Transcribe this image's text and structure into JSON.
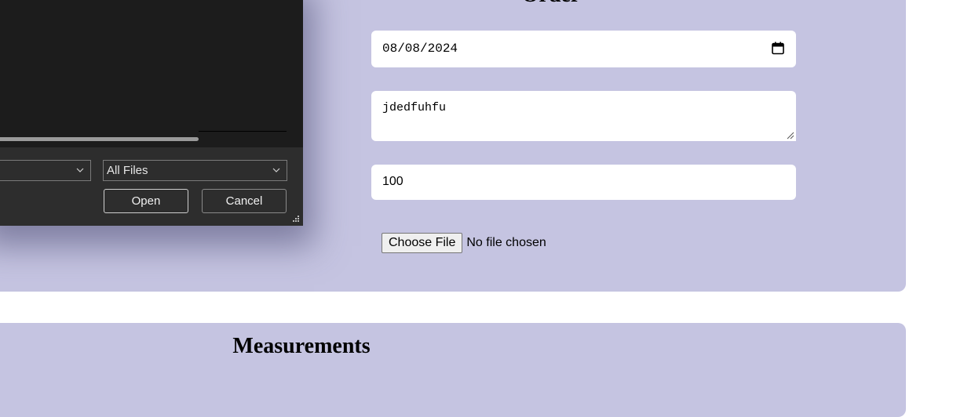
{
  "order": {
    "title": "Order",
    "date_value": "08/08/2024",
    "notes_value": "jdedfuhfu",
    "quantity_value": "100",
    "file_button": "Choose File",
    "file_status": "No file chosen"
  },
  "measurements": {
    "title": "Measurements"
  },
  "file_dialog": {
    "file_type": "All Files",
    "open_label": "Open",
    "cancel_label": "Cancel"
  },
  "colors": {
    "panel_bg": "#c5c4e1",
    "dialog_bg": "#2d2d2d"
  }
}
